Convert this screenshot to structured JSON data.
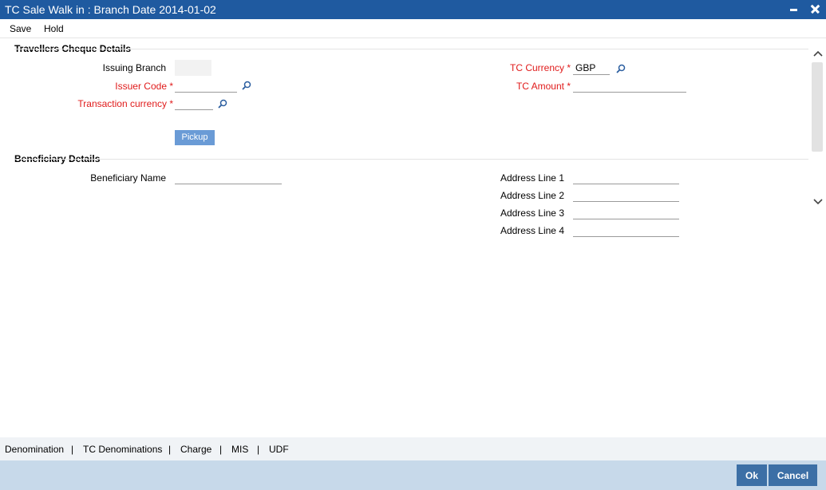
{
  "window": {
    "title": "TC Sale Walk in : Branch Date 2014-01-02",
    "icons": [
      "minimize-icon",
      "close-icon"
    ]
  },
  "menu": {
    "save": "Save",
    "hold": "Hold"
  },
  "travellers_cheque": {
    "section_title": "Travellers Cheque Details",
    "issuing_branch_label": "Issuing Branch",
    "issuing_branch_value": "",
    "issuer_code_label": "Issuer Code *",
    "issuer_code_value": "",
    "transaction_currency_label": "Transaction currency *",
    "transaction_currency_value": "",
    "tc_currency_label": "TC Currency *",
    "tc_currency_value": "GBP",
    "tc_amount_label": "TC Amount *",
    "tc_amount_value": "",
    "pickup_button": "Pickup"
  },
  "beneficiary": {
    "section_title": "Beneficiary Details",
    "name_label": "Beneficiary Name",
    "name_value": "",
    "address1_label": "Address Line 1",
    "address2_label": "Address Line 2",
    "address3_label": "Address Line 3",
    "address4_label": "Address Line 4",
    "address1_value": "",
    "address2_value": "",
    "address3_value": "",
    "address4_value": ""
  },
  "footer_tabs": {
    "denomination": "Denomination",
    "tc_denominations": "TC Denominations",
    "charge": "Charge",
    "mis": "MIS",
    "udf": "UDF",
    "separator": "|"
  },
  "footer_actions": {
    "ok": "Ok",
    "cancel": "Cancel"
  },
  "colors": {
    "titlebar": "#1f5aa0",
    "required_label": "#e01b1b",
    "button": "#3c6fa6",
    "footer_bg": "#c7d9ea"
  }
}
